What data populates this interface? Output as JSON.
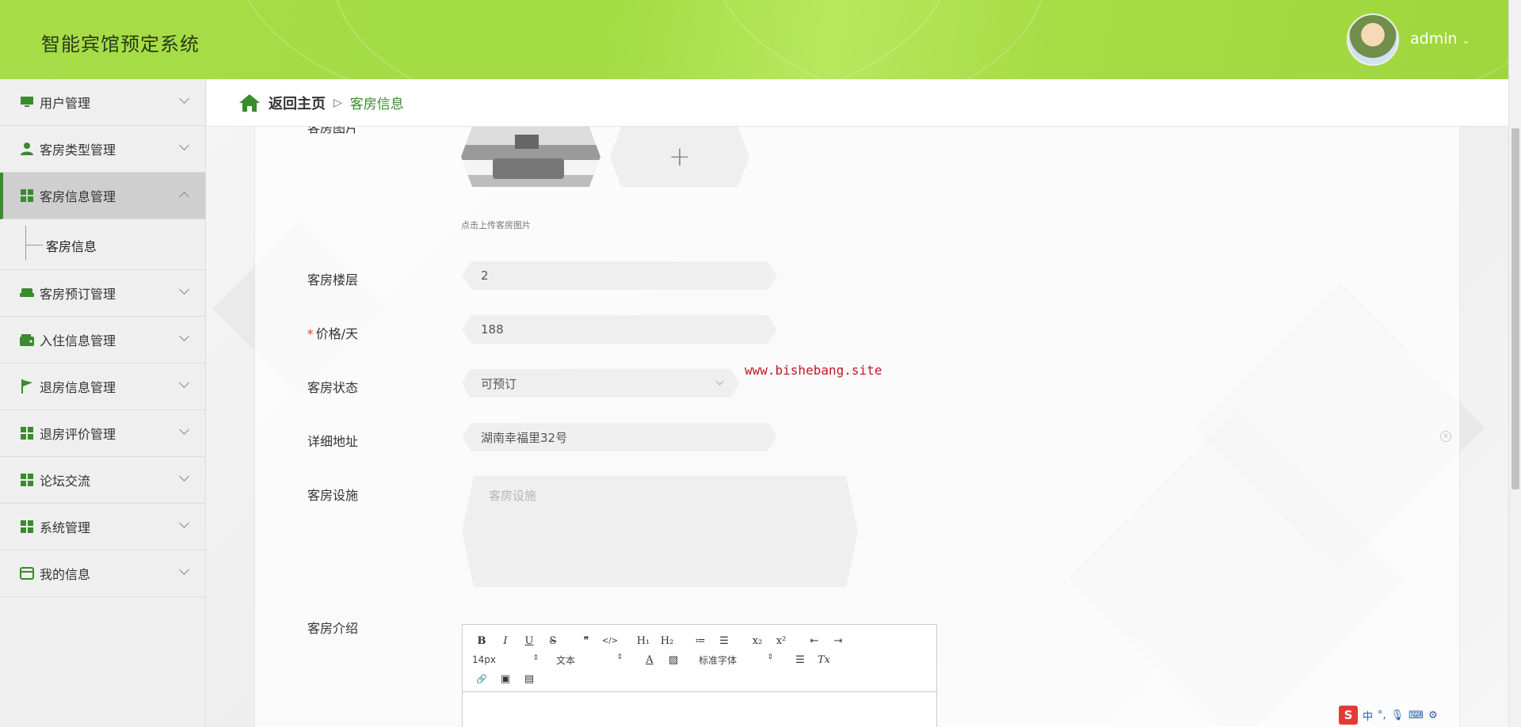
{
  "header": {
    "title": "智能宾馆预定系统",
    "username": "admin"
  },
  "sidebar": {
    "items": [
      {
        "label": "用户管理",
        "icon": "monitor-icon"
      },
      {
        "label": "客房类型管理",
        "icon": "user-icon"
      },
      {
        "label": "客房信息管理",
        "icon": "grid-icon",
        "expanded": true
      },
      {
        "label": "客房预订管理",
        "icon": "sofa-icon"
      },
      {
        "label": "入住信息管理",
        "icon": "wallet-icon"
      },
      {
        "label": "退房信息管理",
        "icon": "flag-icon"
      },
      {
        "label": "退房评价管理",
        "icon": "grid-icon"
      },
      {
        "label": "论坛交流",
        "icon": "grid-icon"
      },
      {
        "label": "系统管理",
        "icon": "grid-icon"
      },
      {
        "label": "我的信息",
        "icon": "card-icon"
      }
    ],
    "submenu": {
      "label": "客房信息"
    }
  },
  "breadcrumb": {
    "home": "返回主页",
    "separator": "▷",
    "current": "客房信息"
  },
  "form": {
    "image": {
      "label": "客房图片",
      "hint": "点击上传客房图片",
      "add_symbol": "+"
    },
    "floor": {
      "label": "客房楼层",
      "value": "2"
    },
    "price": {
      "label": "价格/天",
      "required_mark": "*",
      "value": "188"
    },
    "status": {
      "label": "客房状态",
      "value": "可预订"
    },
    "address": {
      "label": "详细地址",
      "value": "湖南幸福里32号"
    },
    "facilities": {
      "label": "客房设施",
      "placeholder": "客房设施"
    },
    "intro": {
      "label": "客房介绍"
    }
  },
  "editor": {
    "row1": [
      "B",
      "I",
      "U",
      "S",
      "❞",
      "</>",
      "H₁",
      "H₂",
      "≔",
      "☰",
      "x₂",
      "x²",
      "⇤",
      "⇥"
    ],
    "font_size": "14px",
    "text_type": "文本",
    "font_family": "标准字体",
    "row3": [
      "🔗",
      "▣",
      "▤"
    ]
  },
  "watermark": "www.bishebang.site",
  "taskbar": {
    "logo": "S",
    "ime": "中"
  },
  "colors": {
    "accent": "#3a8a2e",
    "header": "#a7dd48",
    "required": "#e53935",
    "watermark": "#c0182b"
  }
}
